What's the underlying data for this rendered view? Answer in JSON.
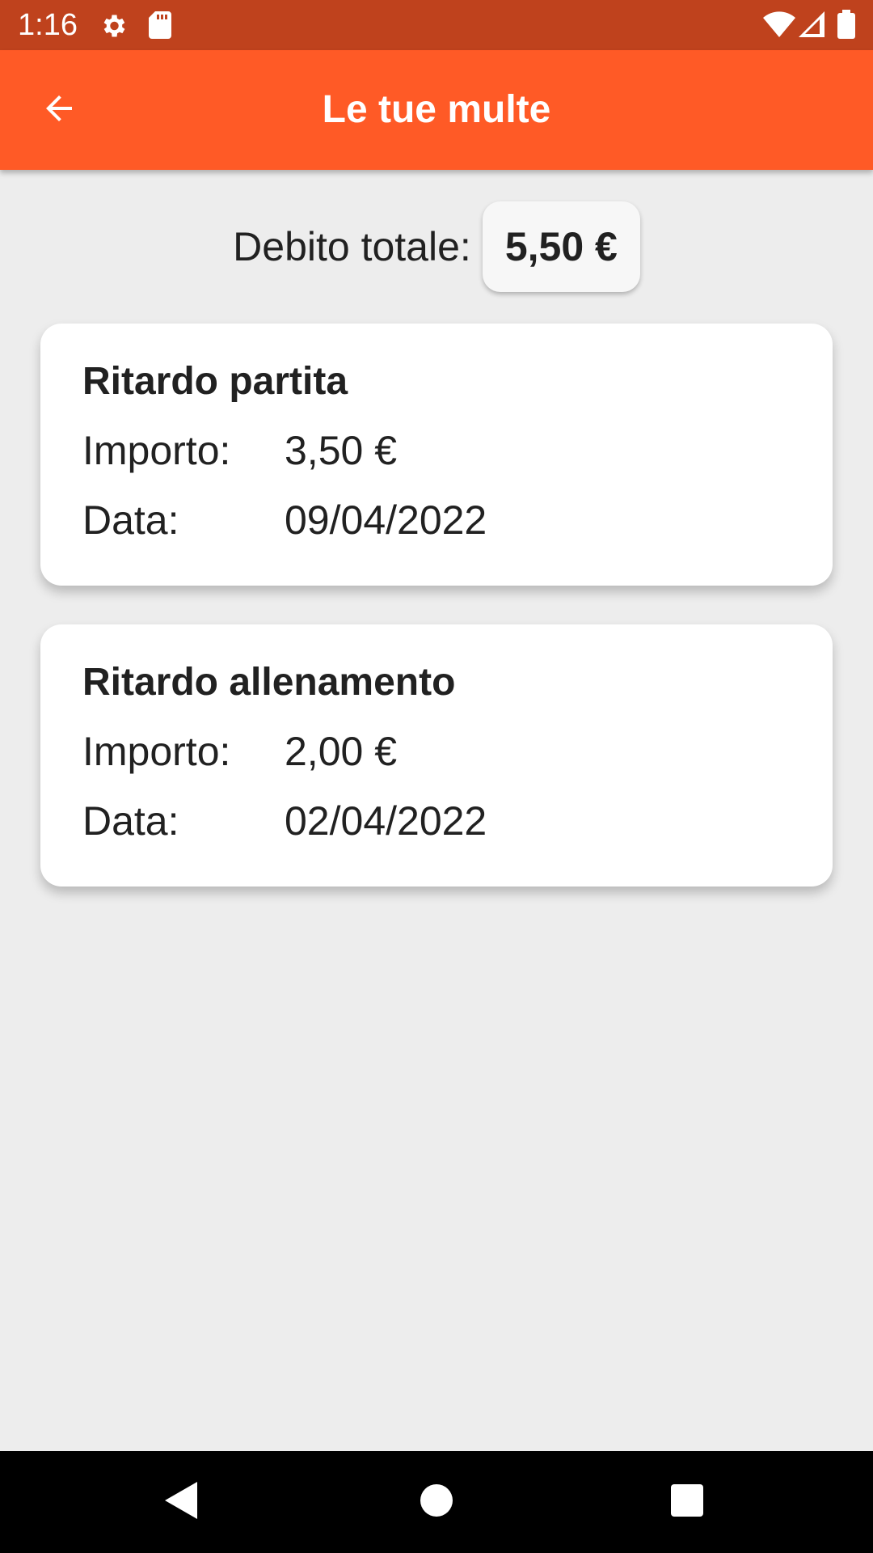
{
  "status_bar": {
    "time": "1:16",
    "icons": [
      "settings-icon",
      "sd-card-icon",
      "wifi-icon",
      "signal-icon",
      "battery-icon"
    ]
  },
  "app_bar": {
    "title": "Le tue multe",
    "back_icon": "arrow-left-icon",
    "color": "#ff5a26"
  },
  "summary": {
    "label": "Debito totale:",
    "value": "5,50 €"
  },
  "fines": [
    {
      "title": "Ritardo partita",
      "amount_label": "Importo:",
      "amount": "3,50 €",
      "date_label": "Data:",
      "date": "09/04/2022"
    },
    {
      "title": "Ritardo allenamento",
      "amount_label": "Importo:",
      "amount": "2,00 €",
      "date_label": "Data:",
      "date": "02/04/2022"
    }
  ],
  "nav_bar": {
    "icons": [
      "back-triangle-icon",
      "home-circle-icon",
      "recents-square-icon"
    ]
  }
}
